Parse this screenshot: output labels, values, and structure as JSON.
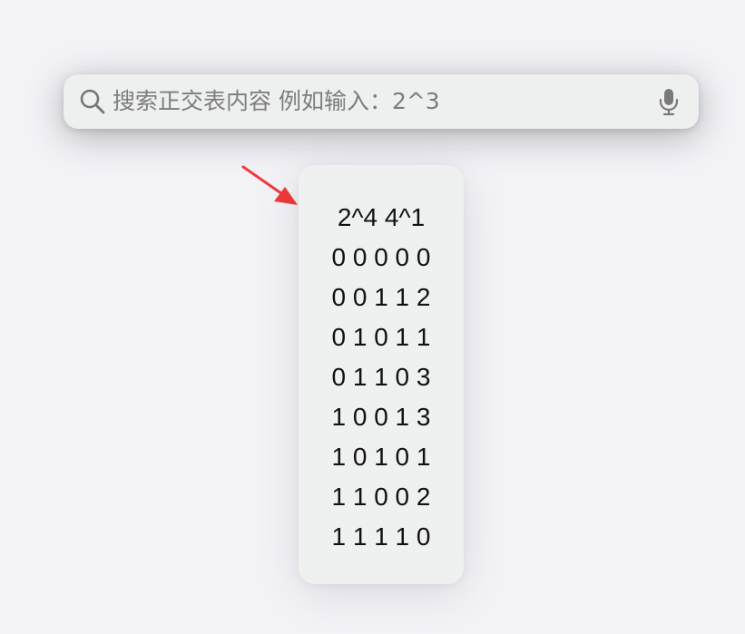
{
  "search": {
    "placeholder": "搜索正交表内容 例如输入：2^3"
  },
  "result": {
    "lines": [
      "2^4 4^1",
      "0 0 0 0 0",
      "0 0 1 1 2",
      "0 1 0 1 1",
      "0 1 1 0 3",
      "1 0 0 1 3",
      "1 0 1 0 1",
      "1 1 0 0 2",
      "1 1 1 1 0"
    ]
  },
  "icons": {
    "search": "search-icon",
    "mic": "microphone-icon",
    "arrow": "arrow-icon"
  },
  "colors": {
    "arrow": "#f03a3a",
    "background": "#f3f2f7",
    "card": "#eff0f0"
  }
}
